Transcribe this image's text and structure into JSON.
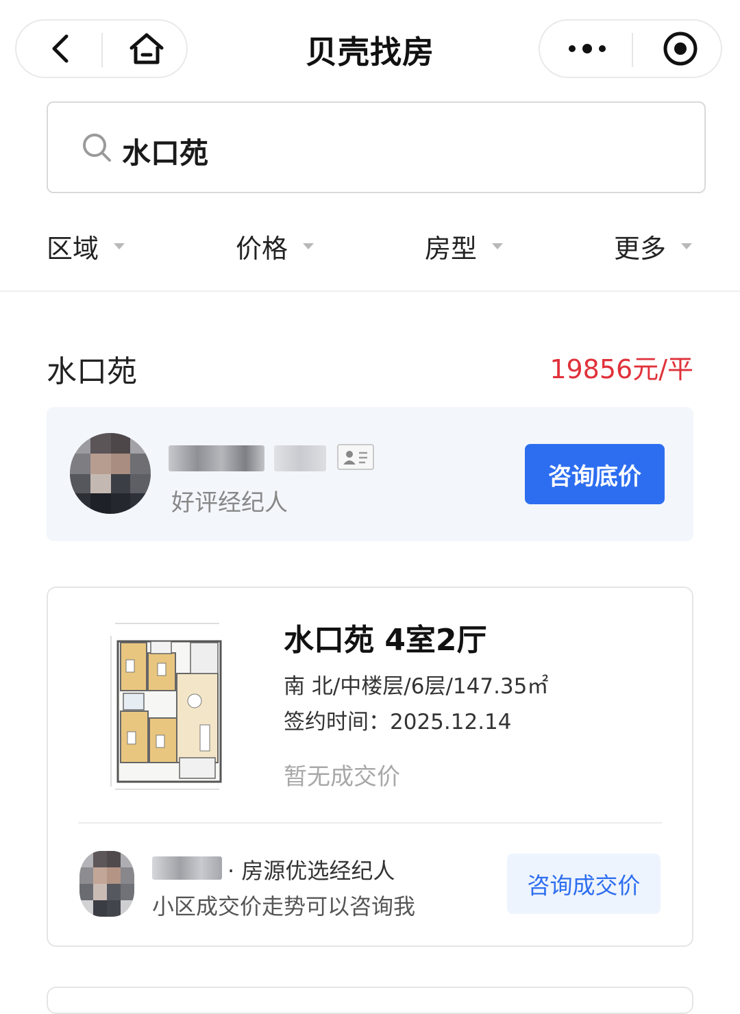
{
  "app": {
    "title": "贝壳找房"
  },
  "nav": {
    "back_icon": "chevron-left-icon",
    "home_icon": "home-icon",
    "more_icon": "more-dots-icon",
    "close_icon": "target-circle-icon"
  },
  "search": {
    "value": "水口苑",
    "icon": "search-icon"
  },
  "filters": [
    {
      "label": "区域"
    },
    {
      "label": "价格"
    },
    {
      "label": "房型"
    },
    {
      "label": "更多"
    }
  ],
  "community": {
    "name": "水口苑",
    "avg_price": "19856元/平",
    "price_color": "#e0313a"
  },
  "featured_agent": {
    "subtitle": "好评经纪人",
    "badge_icon": "id-card-icon",
    "button_label": "咨询底价",
    "button_color": "#2d6ef0"
  },
  "listing": {
    "title": "水口苑 4室2厅",
    "meta": "南 北/中楼层/6层/147.35㎡",
    "sign_date": "签约时间：2025.12.14",
    "deal_price": "暂无成交价",
    "agent": {
      "role": "· 房源优选经纪人",
      "tagline": "小区成交价走势可以咨询我",
      "button_label": "咨询成交价"
    }
  }
}
